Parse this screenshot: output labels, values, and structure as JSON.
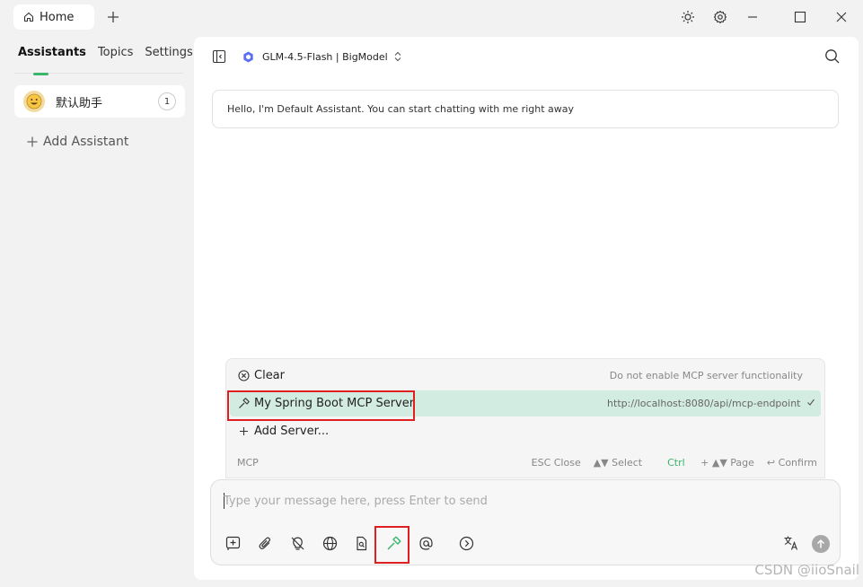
{
  "titlebar": {
    "home_tab_label": "Home"
  },
  "sidebar": {
    "tabs": [
      {
        "label": "Assistants",
        "active": true
      },
      {
        "label": "Topics",
        "active": false
      },
      {
        "label": "Settings",
        "active": false
      }
    ],
    "assistant": {
      "name": "默认助手",
      "count": "1"
    },
    "add_assistant_label": "Add Assistant"
  },
  "header": {
    "model_label": "GLM-4.5-Flash | BigModel"
  },
  "chat": {
    "greeting": "Hello, I'm Default Assistant. You can start chatting with me right away"
  },
  "mcp_popup": {
    "items": [
      {
        "label": "Clear",
        "description": "Do not enable MCP server functionality",
        "icon": "clear-circle-icon"
      },
      {
        "label": "My Spring Boot MCP Server",
        "description": "http://localhost:8080/api/mcp-endpoint",
        "icon": "hammer-icon",
        "selected": true
      },
      {
        "label": "Add Server...",
        "description": "",
        "icon": "plus-icon"
      }
    ],
    "footer_label": "MCP",
    "shortcuts": {
      "close": "ESC Close",
      "select": "▲▼ Select",
      "ctrl": "Ctrl",
      "page": "+ ▲▼ Page",
      "confirm": "↩ Confirm"
    }
  },
  "input": {
    "placeholder": "Type your message here, press Enter to send"
  },
  "colors": {
    "accent": "#3ab56b",
    "selected_row": "#d3ece1",
    "highlight_border": "#e02020"
  },
  "watermark": "CSDN @iioSnail"
}
